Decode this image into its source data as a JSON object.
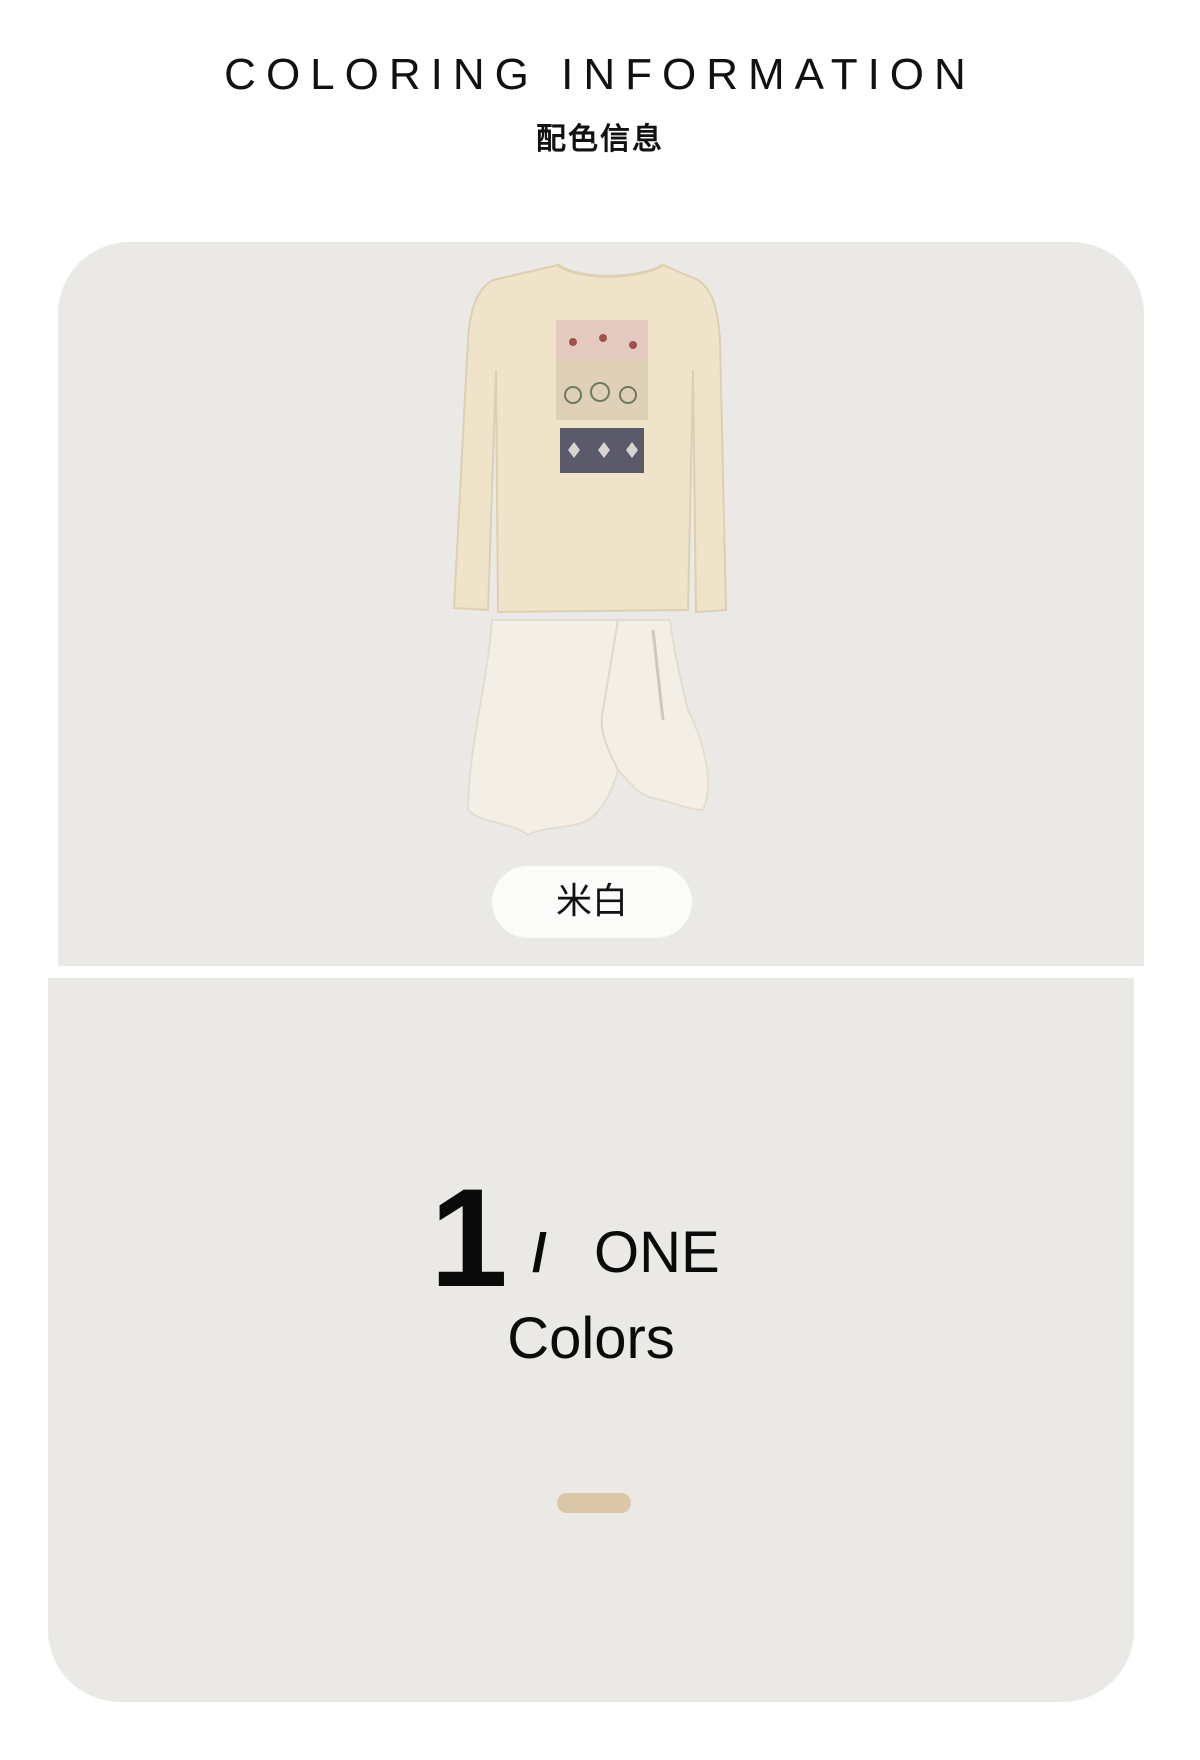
{
  "header": {
    "title": "COLORING INFORMATION",
    "subtitle": "配色信息"
  },
  "product": {
    "image_icon": "garment-photo",
    "color_name": "米白",
    "colors": {
      "card_background": "#ebe9e5",
      "sweater": "#efe3c9",
      "skirt": "#f2ede4"
    }
  },
  "count": {
    "number": "1",
    "slash": "/",
    "word": "ONE",
    "label": "Colors",
    "swatch_color": "#dbc6a8"
  }
}
